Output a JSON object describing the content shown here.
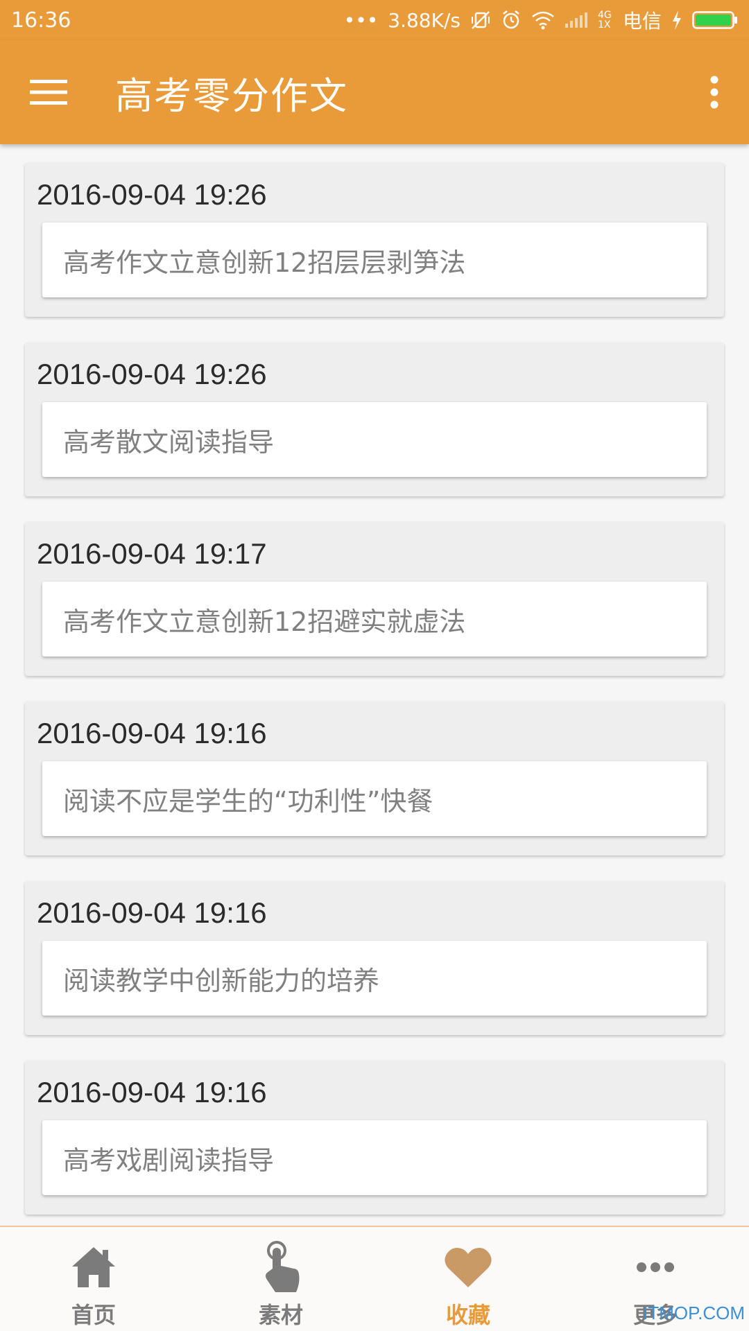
{
  "status_bar": {
    "time": "16:36",
    "overflow": "•••",
    "net_speed": "3.88K/s",
    "network": "4G 1X",
    "carrier": "电信",
    "icons": [
      "vibrate-off-icon",
      "alarm-icon",
      "wifi-icon",
      "signal-icon",
      "charging-icon",
      "battery-icon"
    ]
  },
  "toolbar": {
    "title": "高考零分作文",
    "menu_icon": "hamburger-menu-icon",
    "more_icon": "more-vertical-icon"
  },
  "colors": {
    "primary": "#e99a39",
    "card_bg": "#eeeeee",
    "title_text": "#808080",
    "date_text": "#2b2b2b",
    "nav_inactive": "#7b7b7b",
    "nav_active": "#e99a39"
  },
  "favorites": [
    {
      "date": "2016-09-04 19:26",
      "title": "高考作文立意创新12招层层剥笋法"
    },
    {
      "date": "2016-09-04 19:26",
      "title": "高考散文阅读指导"
    },
    {
      "date": "2016-09-04 19:17",
      "title": "高考作文立意创新12招避实就虚法"
    },
    {
      "date": "2016-09-04 19:16",
      "title": "阅读不应是学生的“功利性”快餐"
    },
    {
      "date": "2016-09-04 19:16",
      "title": "阅读教学中创新能力的培养"
    },
    {
      "date": "2016-09-04 19:16",
      "title": "高考戏剧阅读指导"
    }
  ],
  "bottom_nav": {
    "items": [
      {
        "label": "首页",
        "icon": "home-icon",
        "active": false
      },
      {
        "label": "素材",
        "icon": "touch-hand-icon",
        "active": false
      },
      {
        "label": "收藏",
        "icon": "heart-icon",
        "active": true
      },
      {
        "label": "更多",
        "icon": "more-horizontal-icon",
        "active": false
      }
    ]
  },
  "watermark": "ITMOP.COM"
}
